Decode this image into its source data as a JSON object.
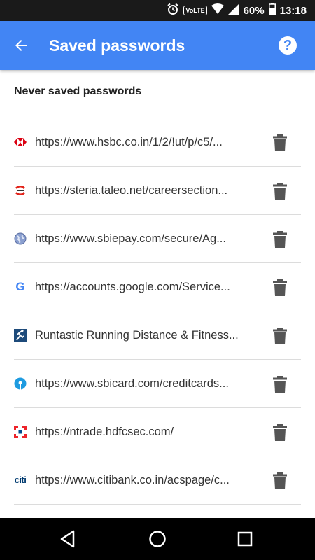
{
  "status_bar": {
    "volte": "VoLTE",
    "battery": "60%",
    "time": "13:18",
    "icons": [
      "alarm-icon",
      "volte-icon",
      "wifi-icon",
      "signal-icon",
      "battery-icon"
    ]
  },
  "app_bar": {
    "title": "Saved passwords",
    "color": "#4285f4",
    "back_icon": "arrow-back-icon",
    "help_icon": "help-icon",
    "help_label": "?"
  },
  "section": {
    "header": "Never saved passwords"
  },
  "items": [
    {
      "text": "https://www.hsbc.co.in/1/2/!ut/p/c5/...",
      "icon": "hsbc-favicon"
    },
    {
      "text": "https://steria.taleo.net/careersection...",
      "icon": "steria-favicon"
    },
    {
      "text": "https://www.sbiepay.com/secure/Ag...",
      "icon": "globe-favicon"
    },
    {
      "text": "https://accounts.google.com/Service...",
      "icon": "google-favicon"
    },
    {
      "text": "Runtastic Running Distance & Fitness...",
      "icon": "runtastic-favicon"
    },
    {
      "text": "https://www.sbicard.com/creditcards...",
      "icon": "sbi-favicon"
    },
    {
      "text": "https://ntrade.hdfcsec.com/",
      "icon": "hdfc-favicon"
    },
    {
      "text": "https://www.citibank.co.in/acspage/c...",
      "icon": "citi-favicon"
    }
  ],
  "favicon_text": {
    "google": "G",
    "citi": "citi"
  },
  "nav_bar": {
    "icons": [
      "back-triangle-icon",
      "home-circle-icon",
      "recents-square-icon"
    ]
  }
}
